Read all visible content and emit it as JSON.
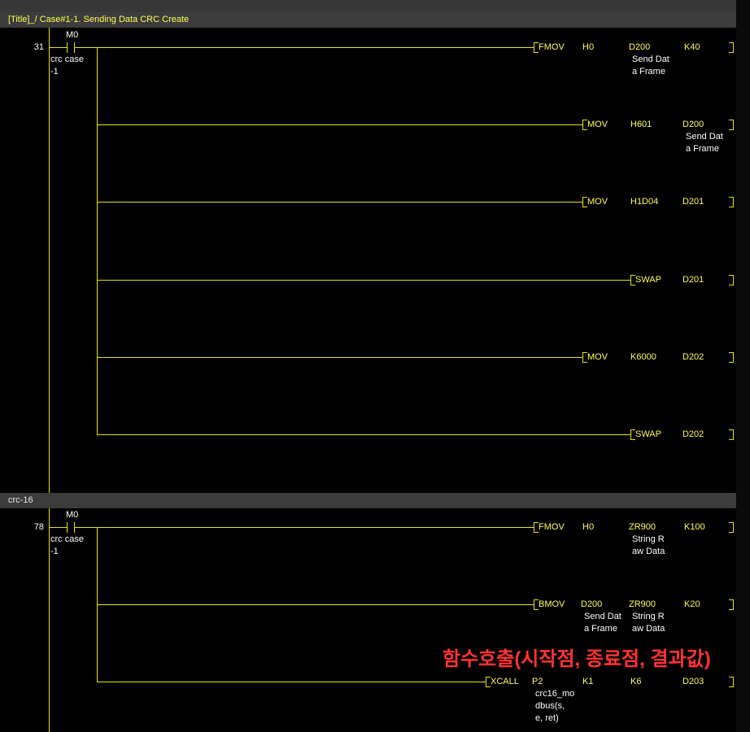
{
  "titles": {
    "block1": "[Title]_/ Case#1-1. Sending Data CRC Create",
    "block2": "crc-16"
  },
  "rungs": {
    "r31": {
      "step": "31",
      "contact": {
        "device": "M0",
        "comment": [
          "crc case",
          "-1"
        ]
      },
      "instructions": [
        {
          "op": "FMOV",
          "ops": [
            "H0",
            "D200",
            "K40"
          ],
          "comment": [
            "Send Dat",
            "a Frame"
          ]
        },
        {
          "op": "MOV",
          "ops": [
            "H601",
            "D200"
          ],
          "comment": [
            "Send Dat",
            "a Frame"
          ]
        },
        {
          "op": "MOV",
          "ops": [
            "H1D04",
            "D201"
          ]
        },
        {
          "op": "SWAP",
          "ops": [
            "D201"
          ]
        },
        {
          "op": "MOV",
          "ops": [
            "K6000",
            "D202"
          ]
        },
        {
          "op": "SWAP",
          "ops": [
            "D202"
          ]
        }
      ]
    },
    "r78": {
      "step": "78",
      "contact": {
        "device": "M0",
        "comment": [
          "crc case",
          "-1"
        ]
      },
      "instructions": [
        {
          "op": "FMOV",
          "ops": [
            "H0",
            "ZR900",
            "K100"
          ],
          "comment": [
            "String R",
            "aw Data"
          ]
        },
        {
          "op": "BMOV",
          "ops": [
            "D200",
            "ZR900",
            "K20"
          ],
          "comment1": [
            "Send Dat",
            "a Frame"
          ],
          "comment2": [
            "String R",
            "aw Data"
          ]
        },
        {
          "op": "XCALL",
          "ops": [
            "P2",
            "K1",
            "K6",
            "D203"
          ],
          "comment": [
            "crc16_mo",
            "dbus(s,",
            "e, ret)"
          ]
        }
      ]
    }
  },
  "annotation": "함수호출(시작점, 종료점, 결과값)",
  "colors": {
    "ladder": "#e6e600",
    "label": "#ffff55",
    "comment": "#ffffff",
    "annotation": "#ff3333",
    "header": "#3c3c3c",
    "background": "#000000"
  }
}
